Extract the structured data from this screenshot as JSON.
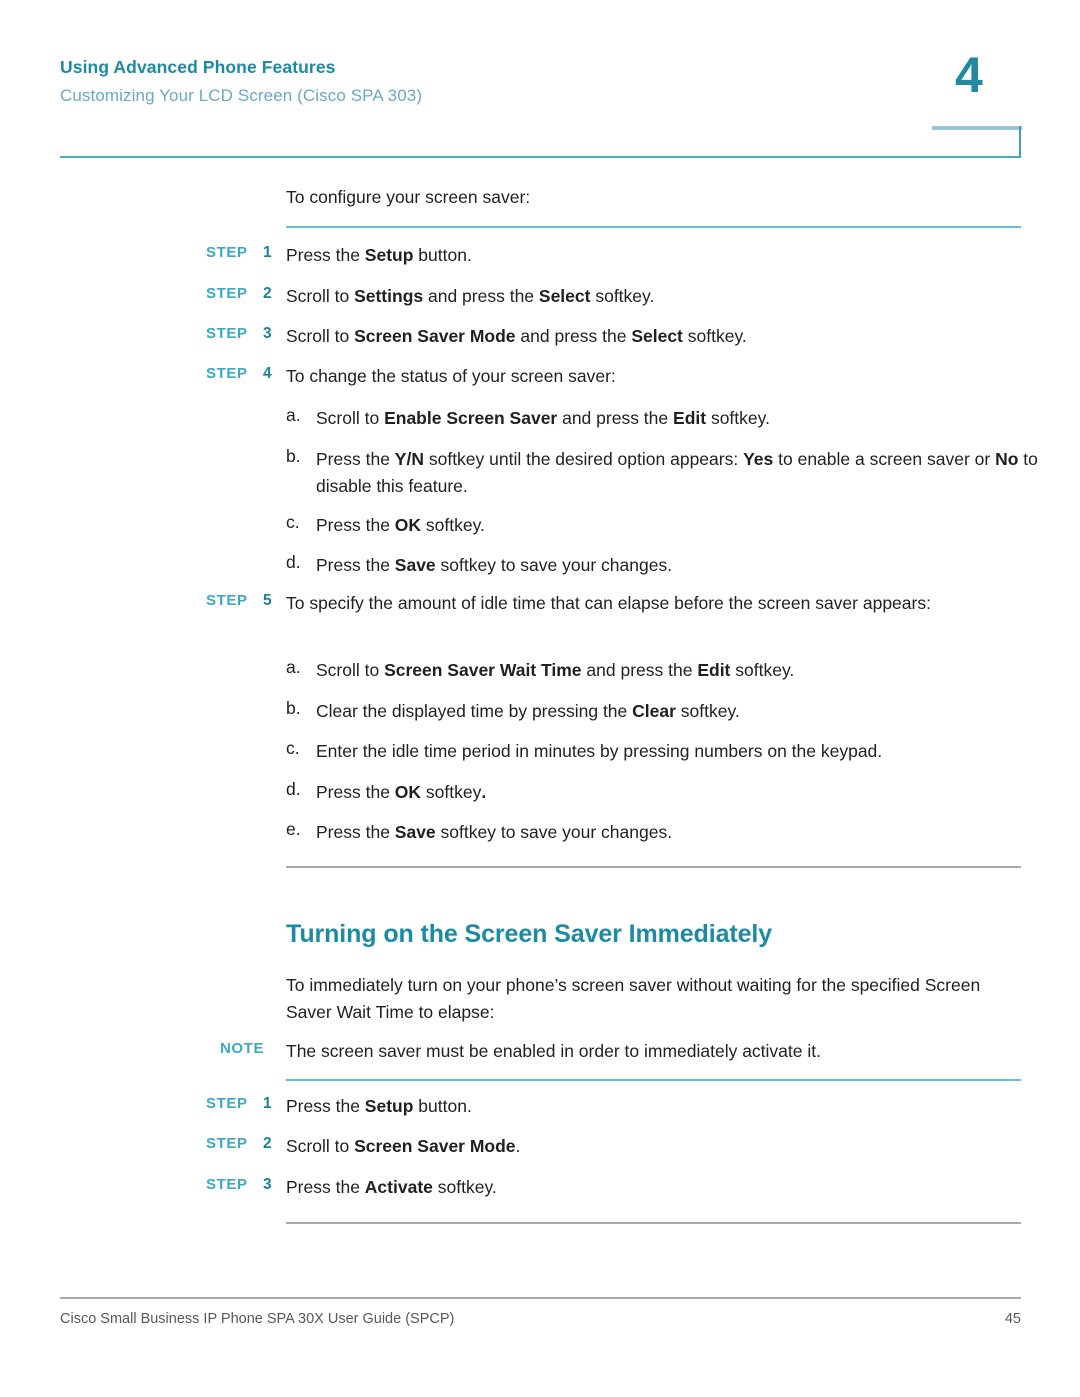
{
  "header": {
    "title": "Using Advanced Phone Features",
    "subtitle": "Customizing Your LCD Screen (Cisco SPA 303)",
    "chapter_number": "4",
    "colors": {
      "title": "#1b8ba5",
      "subtitle": "#6aa9c4",
      "chapter_number": "#2389a0",
      "header_rule": "#4fa8bd",
      "box_top_bar": "#9cc4dc",
      "box_right_edge": "#3f9fb0"
    }
  },
  "section1": {
    "intro": "To configure your screen saver:",
    "step_label": "STEP",
    "steps": [
      {
        "num": "1",
        "html": "Press the <b>Setup</b> button."
      },
      {
        "num": "2",
        "html": "Scroll to <b>Settings</b> and press the <b>Select</b> softkey."
      },
      {
        "num": "3",
        "html": "Scroll to <b>Screen Saver Mode</b> and press the <b>Select</b> softkey."
      },
      {
        "num": "4",
        "html": "To change the status of your screen saver:",
        "substeps": [
          {
            "marker": "a.",
            "html": "Scroll to <b>Enable Screen Saver</b> and press the <b>Edit</b> softkey."
          },
          {
            "marker": "b.",
            "html": "Press the <b>Y/N</b> softkey until the desired option appears: <b>Yes</b> to enable a screen saver or <b>No</b> to disable this feature."
          },
          {
            "marker": "c.",
            "html": "Press the <b>OK</b> softkey."
          },
          {
            "marker": "d.",
            "html": "Press the <b>Save</b> softkey to save your changes."
          }
        ]
      },
      {
        "num": "5",
        "html": "To specify the amount of idle time that can elapse before the screen saver appears:",
        "substeps": [
          {
            "marker": "a.",
            "html": "Scroll to <b>Screen Saver Wait Time</b> and press the <b>Edit</b> softkey."
          },
          {
            "marker": "b.",
            "html": "Clear the displayed time by pressing the <b>Clear</b> softkey."
          },
          {
            "marker": "c.",
            "html": "Enter the idle time period in minutes by pressing numbers on the keypad."
          },
          {
            "marker": "d.",
            "html": "Press the <b>OK</b> softkey<b>.</b>"
          },
          {
            "marker": "e.",
            "html": "Press the <b>Save</b> softkey to save your changes."
          }
        ]
      }
    ]
  },
  "section2": {
    "heading": "Turning on the Screen Saver Immediately",
    "paragraph": "To immediately turn on your phone’s screen saver without waiting for the specified Screen Saver Wait Time to elapse:",
    "note_label": "NOTE",
    "note_text": "The screen saver must be enabled in order to immediately activate it.",
    "step_label": "STEP",
    "steps": [
      {
        "num": "1",
        "html": "Press the <b>Setup</b> button."
      },
      {
        "num": "2",
        "html": "Scroll to <b>Screen Saver Mode</b>."
      },
      {
        "num": "3",
        "html": "Press the <b>Activate</b> softkey."
      }
    ]
  },
  "footer": {
    "document_title": "Cisco Small Business IP Phone SPA 30X User Guide (SPCP)",
    "page_number": "45"
  }
}
